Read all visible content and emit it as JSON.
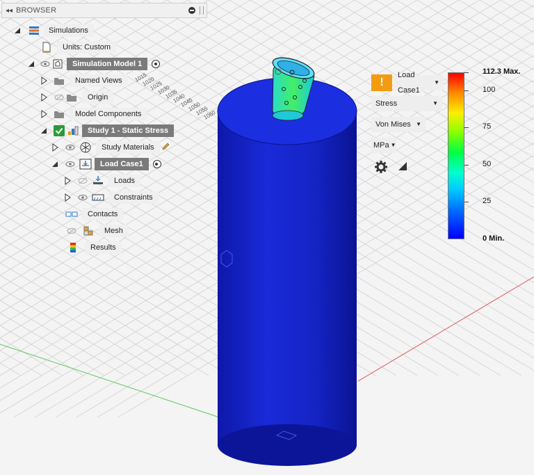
{
  "browser": {
    "title": "BROWSER"
  },
  "tree": {
    "simulations": "Simulations",
    "units": "Units: Custom",
    "simulation_model": "Simulation Model 1",
    "named_views": "Named Views",
    "origin": "Origin",
    "model_components": "Model Components",
    "study": "Study 1 - Static Stress",
    "study_materials": "Study Materials",
    "load_case": "Load Case1",
    "loads": "Loads",
    "constraints": "Constraints",
    "contacts": "Contacts",
    "mesh": "Mesh",
    "results": "Results"
  },
  "results_panel": {
    "warning": "!",
    "load_case": "Load Case1",
    "result_type": "Stress",
    "component": "Von Mises",
    "unit": "MPa"
  },
  "legend": {
    "max_label": "112.3 Max.",
    "min_label": "0 Min.",
    "ticks": [
      "100",
      "75",
      "50",
      "25"
    ],
    "tick_values": [
      100,
      75,
      50,
      25
    ],
    "max_value": 112.3,
    "min_value": 0
  },
  "viewport": {
    "grid_labels_left": [
      "1015",
      "1020",
      "1025",
      "1030",
      "1035",
      "1040",
      "1045",
      "1050",
      "1055",
      "1060"
    ],
    "colors": {
      "cylinder": "#1420c8",
      "grid": "#d4d4d4",
      "x_axis": "#e06060",
      "y_axis": "#60c060"
    }
  }
}
